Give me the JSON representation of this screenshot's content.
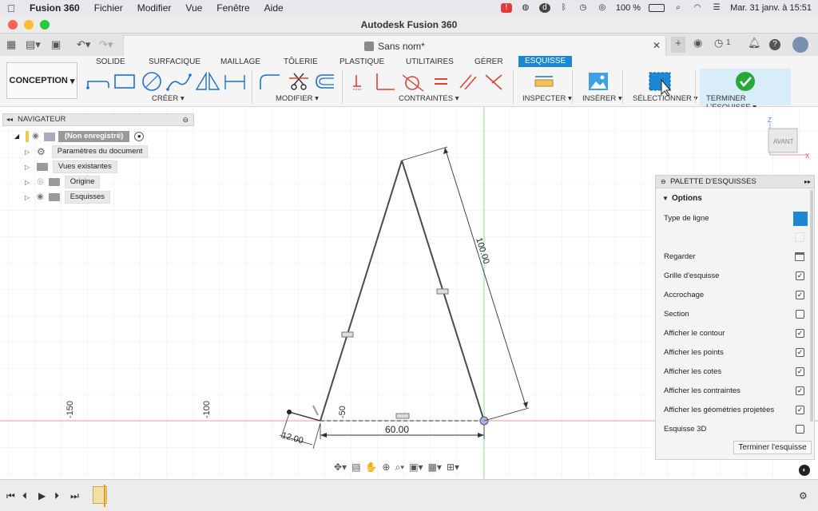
{
  "menubar": {
    "app": "Fusion 360",
    "items": [
      "Fichier",
      "Modifier",
      "Vue",
      "Fenêtre",
      "Aide"
    ],
    "battery": "100 %",
    "clock": "Mar. 31 janv. à  15:51"
  },
  "window": {
    "title": "Autodesk Fusion 360"
  },
  "document": {
    "tab_title": "Sans nom*",
    "jobs_count": "1"
  },
  "ribbon": {
    "workspace": "CONCEPTION",
    "tabs": [
      "SOLIDE",
      "SURFACIQUE",
      "MAILLAGE",
      "TÔLERIE",
      "PLASTIQUE",
      "UTILITAIRES",
      "GÉRER",
      "ESQUISSE"
    ],
    "active_tab": "ESQUISSE",
    "groups": {
      "create": "CRÉER ▾",
      "modify": "MODIFIER ▾",
      "constraints": "CONTRAINTES ▾",
      "inspect": "INSPECTER ▾",
      "insert": "INSÉRER ▾",
      "select": "SÉLECTIONNER ▾",
      "finish": "TERMINER L'ESQUISSE ▾"
    },
    "accent": "#1d87d6"
  },
  "navigator": {
    "title": "NAVIGATEUR",
    "root": "(Non enregistré)",
    "items": [
      "Paramètres du document",
      "Vues existantes",
      "Origine",
      "Esquisses"
    ]
  },
  "viewcube": {
    "face": "AVANT",
    "axis_z": "Z",
    "axis_x": "X"
  },
  "sketch": {
    "dim_side": "100.00",
    "dim_base": "60.00",
    "dim_small": "12.00",
    "axis_labels": [
      "-150",
      "-100",
      "-50"
    ]
  },
  "palette": {
    "title": "PALETTE D'ESQUISSES",
    "section": "Options",
    "rows": [
      {
        "label": "Type de ligne",
        "kind": "linetype"
      },
      {
        "label": "",
        "kind": "blank"
      },
      {
        "label": "Regarder",
        "kind": "look"
      },
      {
        "label": "Grille d'esquisse",
        "checked": true
      },
      {
        "label": "Accrochage",
        "checked": true
      },
      {
        "label": "Section",
        "checked": false
      },
      {
        "label": "Afficher le contour",
        "checked": true
      },
      {
        "label": "Afficher les points",
        "checked": true
      },
      {
        "label": "Afficher les cotes",
        "checked": true
      },
      {
        "label": "Afficher les contraintes",
        "checked": true
      },
      {
        "label": "Afficher les géométries projetées",
        "checked": true
      },
      {
        "label": "Esquisse 3D",
        "checked": false
      }
    ],
    "finish_button": "Terminer l'esquisse"
  }
}
